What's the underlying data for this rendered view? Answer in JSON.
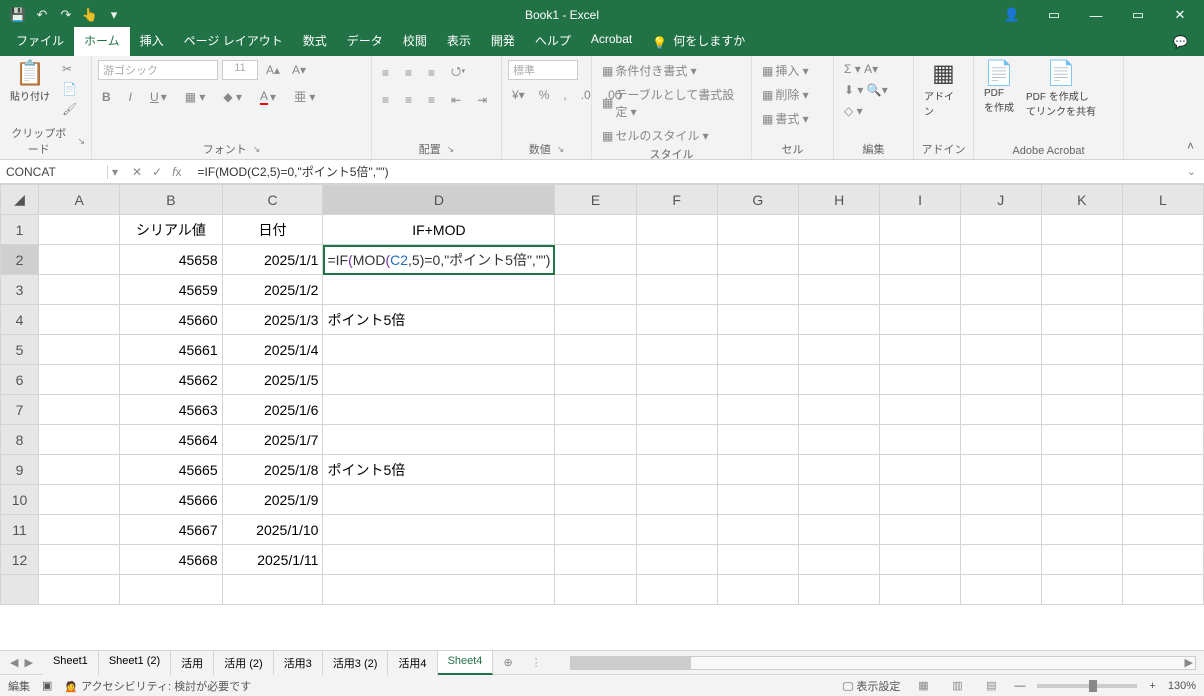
{
  "title": "Book1  -  Excel",
  "qat": {
    "save": "💾",
    "undo": "↶",
    "redo": "↷",
    "touch": "👆"
  },
  "win": {
    "min": "—",
    "max": "▭",
    "close": "✕",
    "ribmode": "▭",
    "user": "👤"
  },
  "tabs": [
    "ファイル",
    "ホーム",
    "挿入",
    "ページ レイアウト",
    "数式",
    "データ",
    "校閲",
    "表示",
    "開発",
    "ヘルプ",
    "Acrobat"
  ],
  "tellme": "何をしますか",
  "ribbon": {
    "clipboard": {
      "label": "クリップボード",
      "paste": "貼り付け"
    },
    "font": {
      "label": "フォント",
      "name": "游ゴシック",
      "size": "11"
    },
    "align": {
      "label": "配置"
    },
    "number": {
      "label": "数値",
      "fmt": "標準"
    },
    "styles": {
      "label": "スタイル",
      "cond": "条件付き書式 ▾",
      "table": "テーブルとして書式設定 ▾",
      "cell": "セルのスタイル ▾"
    },
    "cells": {
      "label": "セル",
      "insert": "挿入 ▾",
      "delete": "削除 ▾",
      "format": "書式 ▾"
    },
    "editing": {
      "label": "編集"
    },
    "addin": {
      "label": "アドイン",
      "btn": "アドイン"
    },
    "acrobat": {
      "label": "Adobe Acrobat",
      "create": "PDF\nを作成",
      "share": "PDF を作成し\nてリンクを共有"
    }
  },
  "fbar": {
    "name": "CONCAT",
    "formula": "=IF(MOD(C2,5)=0,\"ポイント5倍\",\"\")"
  },
  "cols": [
    "A",
    "B",
    "C",
    "D",
    "E",
    "F",
    "G",
    "H",
    "I",
    "J",
    "K",
    "L"
  ],
  "headers": {
    "B": "シリアル値",
    "C": "日付",
    "D": "IF+MOD"
  },
  "rows": [
    {
      "n": 1
    },
    {
      "n": 2,
      "B": "45658",
      "C": "2025/1/1",
      "D_formula": true,
      "sel": true
    },
    {
      "n": 3,
      "B": "45659",
      "C": "2025/1/2"
    },
    {
      "n": 4,
      "B": "45660",
      "C": "2025/1/3",
      "D": "ポイント5倍"
    },
    {
      "n": 5,
      "B": "45661",
      "C": "2025/1/4"
    },
    {
      "n": 6,
      "B": "45662",
      "C": "2025/1/5"
    },
    {
      "n": 7,
      "B": "45663",
      "C": "2025/1/6"
    },
    {
      "n": 8,
      "B": "45664",
      "C": "2025/1/7"
    },
    {
      "n": 9,
      "B": "45665",
      "C": "2025/1/8",
      "D": "ポイント5倍"
    },
    {
      "n": 10,
      "B": "45666",
      "C": "2025/1/9"
    },
    {
      "n": 11,
      "B": "45667",
      "C": "2025/1/10"
    },
    {
      "n": 12,
      "B": "45668",
      "C": "2025/1/11"
    }
  ],
  "formula_render": {
    "pre": "=IF",
    "p1": "(",
    "mod": "MOD",
    "p2": "(",
    "ref": "C2",
    "rest": ",5)=0,\"ポイント5倍\",\"\")"
  },
  "sheets": [
    "Sheet1",
    "Sheet1 (2)",
    "活用",
    "活用 (2)",
    "活用3",
    "活用3 (2)",
    "活用4",
    "Sheet4"
  ],
  "status": {
    "mode": "編集",
    "acc": "アクセシビリティ: 検討が必要です",
    "disp": "表示設定",
    "zoom": "130%"
  }
}
